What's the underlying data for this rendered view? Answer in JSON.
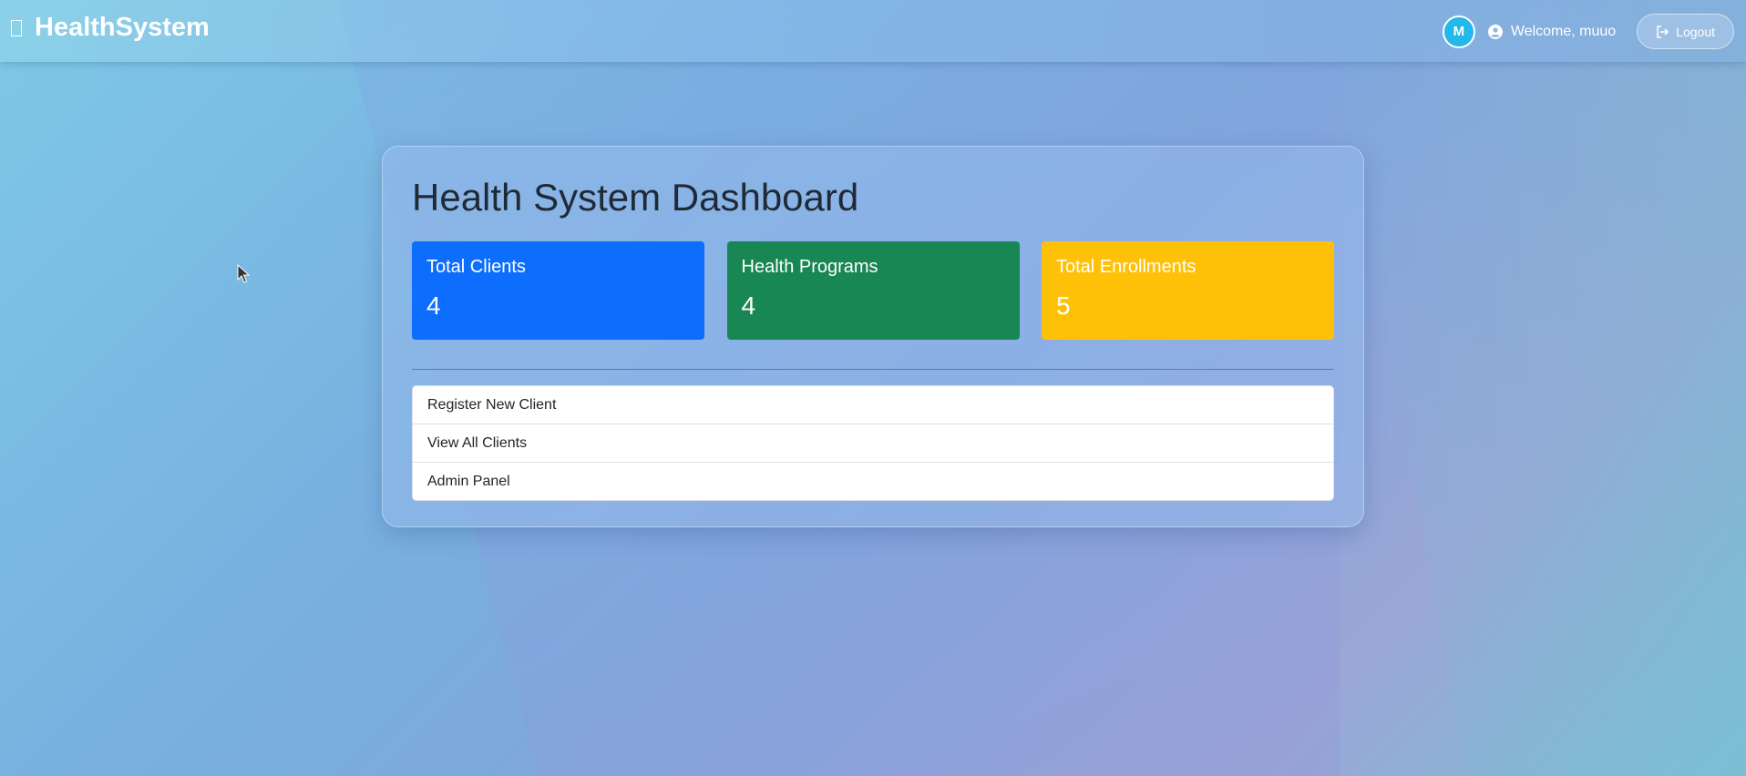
{
  "navbar": {
    "brand": "HealthSystem",
    "avatar_initial": "M",
    "welcome": "Welcome, muuo",
    "logout_label": "Logout"
  },
  "dashboard": {
    "title": "Health System Dashboard",
    "stats": [
      {
        "label": "Total Clients",
        "value": "4",
        "color": "#0d6efd"
      },
      {
        "label": "Health Programs",
        "value": "4",
        "color": "#198754"
      },
      {
        "label": "Total Enrollments",
        "value": "5",
        "color": "#ffc107"
      }
    ],
    "actions": [
      {
        "label": "Register New Client"
      },
      {
        "label": "View All Clients"
      },
      {
        "label": "Admin Panel"
      }
    ]
  },
  "icons": {
    "brand": "heart-pulse-icon",
    "user": "user-circle-icon",
    "logout": "sign-out-icon"
  }
}
